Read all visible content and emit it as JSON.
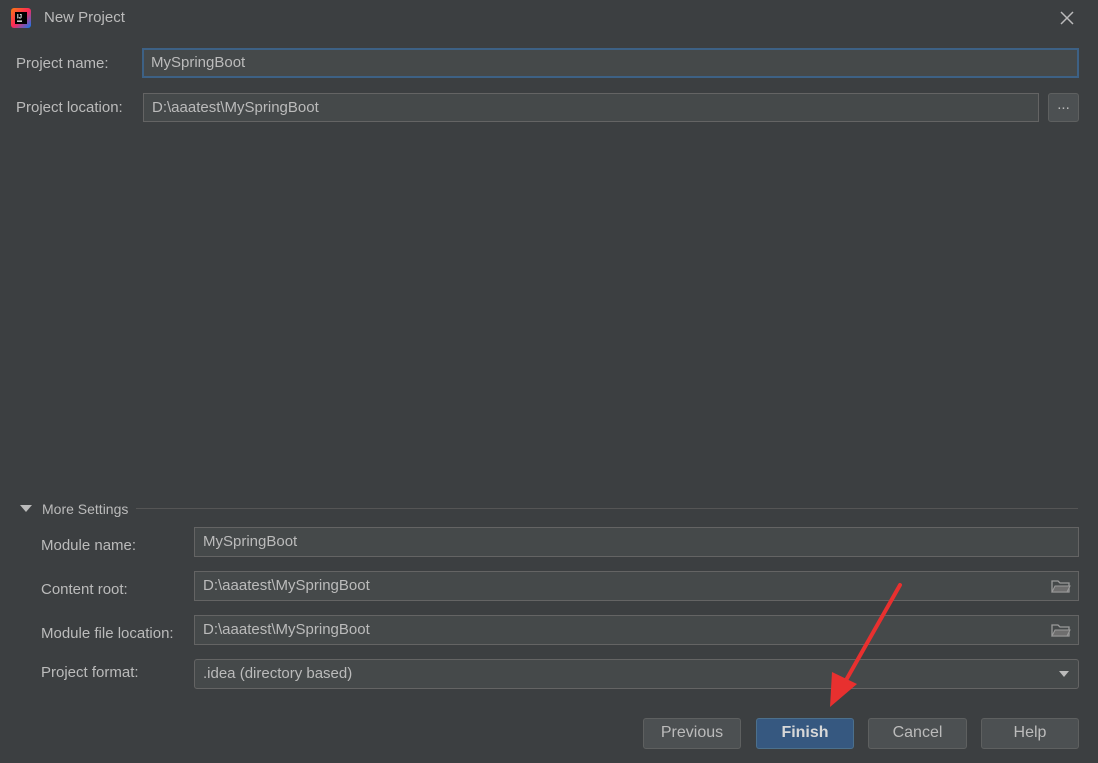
{
  "window": {
    "title": "New Project",
    "app_icon": "intellij-idea-icon",
    "close_icon": "close-icon"
  },
  "form": {
    "project_name": {
      "label": "Project name:",
      "value": "MySpringBoot"
    },
    "project_location": {
      "label": "Project location:",
      "value": "D:\\aaatest\\MySpringBoot",
      "browse_label": "..."
    }
  },
  "more_settings": {
    "header": "More Settings",
    "module_name": {
      "label": "Module name:",
      "value": "MySpringBoot"
    },
    "content_root": {
      "label": "Content root:",
      "value": "D:\\aaatest\\MySpringBoot"
    },
    "module_file_location": {
      "label": "Module file location:",
      "value": "D:\\aaatest\\MySpringBoot"
    },
    "project_format": {
      "label": "Project format:",
      "value": ".idea (directory based)"
    }
  },
  "buttons": {
    "previous": "Previous",
    "finish": "Finish",
    "cancel": "Cancel",
    "help": "Help"
  },
  "colors": {
    "background": "#3c3f41",
    "field_bg": "#45494a",
    "focus_border": "#3d6185",
    "default_button": "#365880",
    "annotation_arrow": "#e8302f"
  }
}
